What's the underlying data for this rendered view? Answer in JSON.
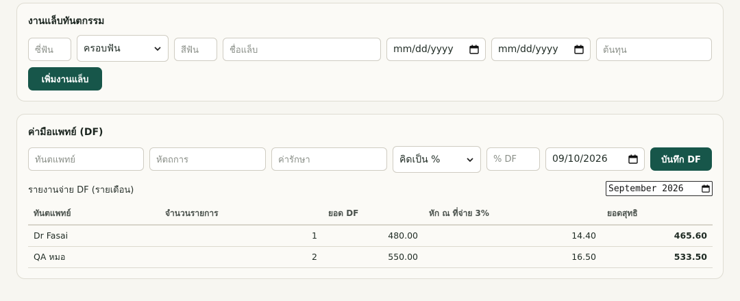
{
  "lab": {
    "title": "งานแล็บทันตกรรม",
    "tooth_placeholder": "ซี่ฟัน",
    "type_selected": "ครอบฟัน",
    "shade_placeholder": "สีฟัน",
    "labname_placeholder": "ชื่อแล็บ",
    "date1_value": "mm/dd/yyyy",
    "date2_value": "mm/dd/yyyy",
    "cost_placeholder": "ต้นทุน",
    "add_label": "เพิ่มงานแล็บ"
  },
  "df": {
    "title": "ค่ามือแพทย์ (DF)",
    "dentist_placeholder": "ทันตแพทย์",
    "procedure_placeholder": "หัตถการ",
    "fee_placeholder": "ค่ารักษา",
    "mode_selected": "คิดเป็น %",
    "percent_placeholder": "% DF",
    "date_value": "09/10/2026",
    "save_label": "บันทึก DF",
    "report_label": "รายงานจ่าย DF (รายเดือน)",
    "month_value": "September 2026",
    "columns": [
      "ทันตแพทย์",
      "จำนวนรายการ",
      "ยอด DF",
      "หัก ณ ที่จ่าย 3%",
      "ยอดสุทธิ"
    ],
    "rows": [
      {
        "dentist": "Dr Fasai",
        "count": "1",
        "df": "480.00",
        "wht": "14.40",
        "net": "465.60"
      },
      {
        "dentist": "QA หมอ",
        "count": "2",
        "df": "550.00",
        "wht": "16.50",
        "net": "533.50"
      }
    ]
  },
  "colors": {
    "accent": "#17564a",
    "background": "#f7f6f1",
    "card": "#fbfaf6"
  },
  "icons": {
    "select_arrow": "chevron-down-icon",
    "date_picker": "calendar-icon"
  }
}
